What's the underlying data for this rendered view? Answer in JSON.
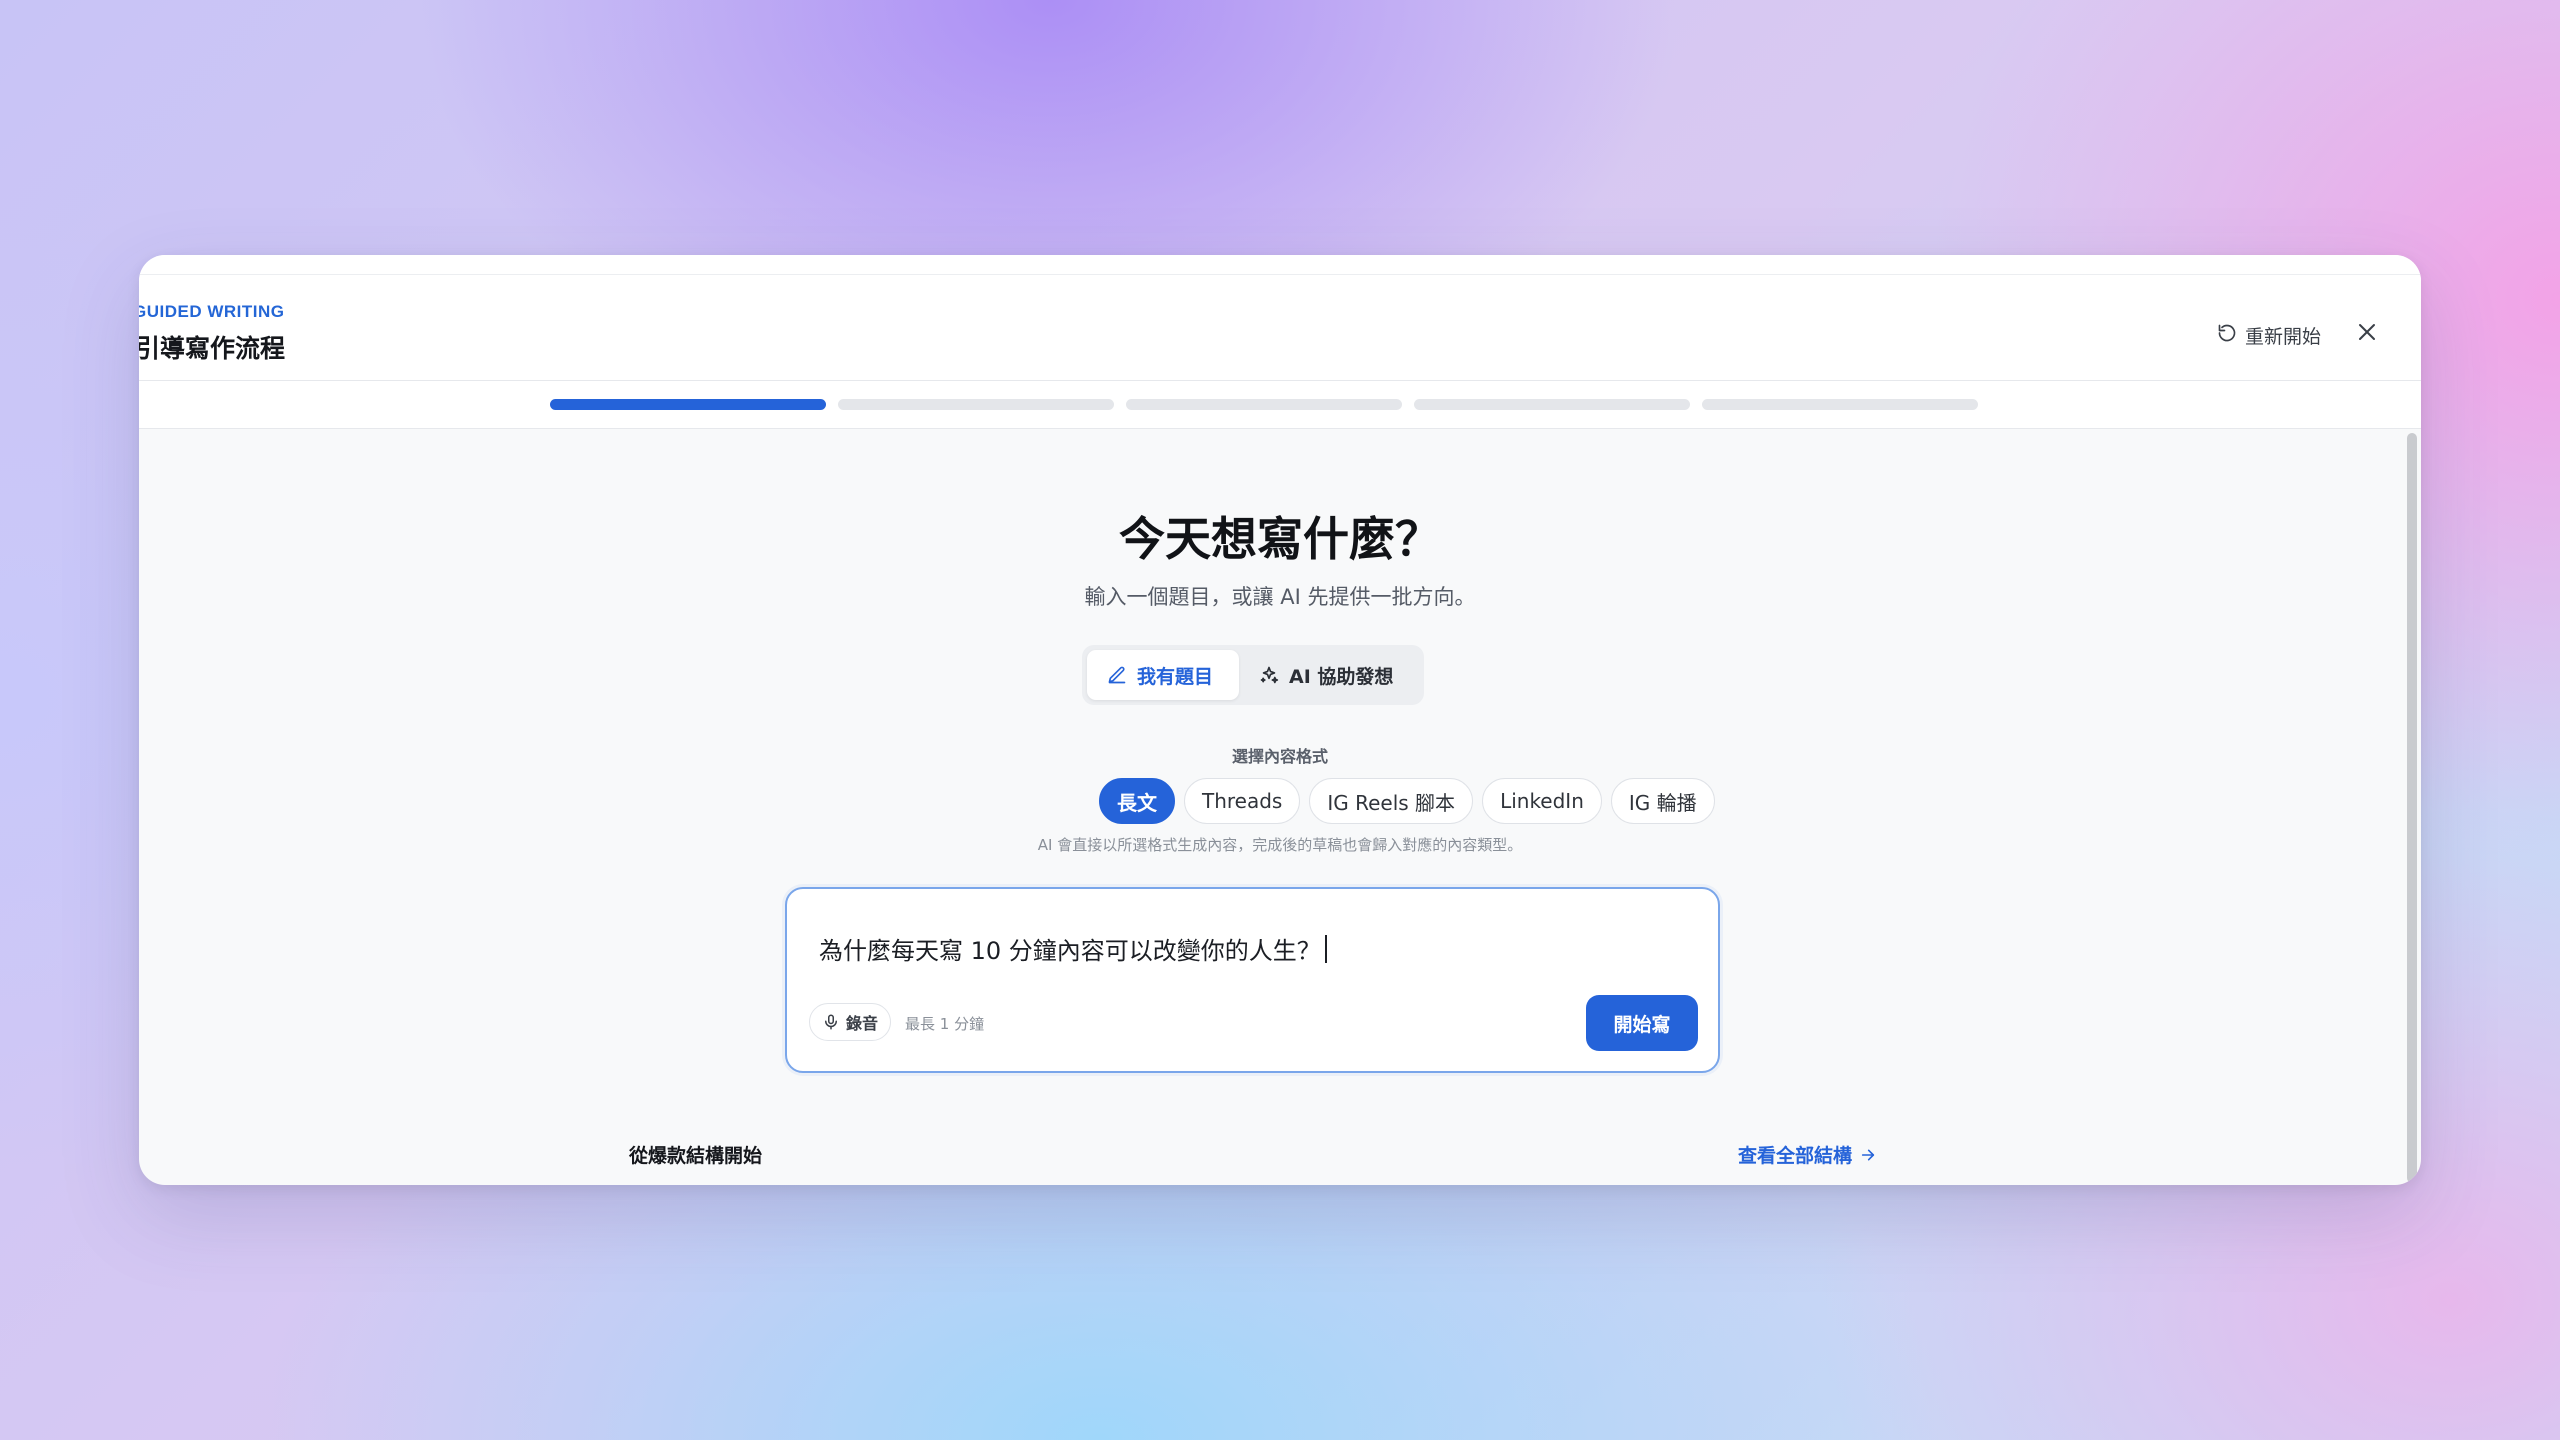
{
  "header": {
    "eyebrow": "GUIDED WRITING",
    "title": "引導寫作流程",
    "restart_label": "重新開始"
  },
  "progress": {
    "total_steps": 5,
    "current_step": 1
  },
  "main": {
    "heading": "今天想寫什麼？",
    "subheading": "輸入一個題目，或讓 AI 先提供一批方向。",
    "modes": [
      {
        "label": "我有題目",
        "icon": "pencil-icon",
        "active": true
      },
      {
        "label": "AI 協助發想",
        "icon": "sparkles-icon",
        "active": false
      }
    ],
    "format_label": "選擇內容格式",
    "formats": [
      "長文",
      "Threads",
      "IG Reels 腳本",
      "LinkedIn",
      "IG 輪播"
    ],
    "selected_format": "長文",
    "format_hint": "AI 會直接以所選格式生成內容，完成後的草稿也會歸入對應的內容類型。",
    "input": {
      "value": "為什麼每天寫 10 分鐘內容可以改變你的人生？",
      "record_label": "錄音",
      "record_limit": "最長 1 分鐘",
      "submit_label": "開始寫"
    },
    "structures": {
      "title": "從爆款結構開始",
      "link_label": "查看全部結構"
    }
  },
  "colors": {
    "accent": "#2563d9",
    "track": "#e4e6ea"
  }
}
